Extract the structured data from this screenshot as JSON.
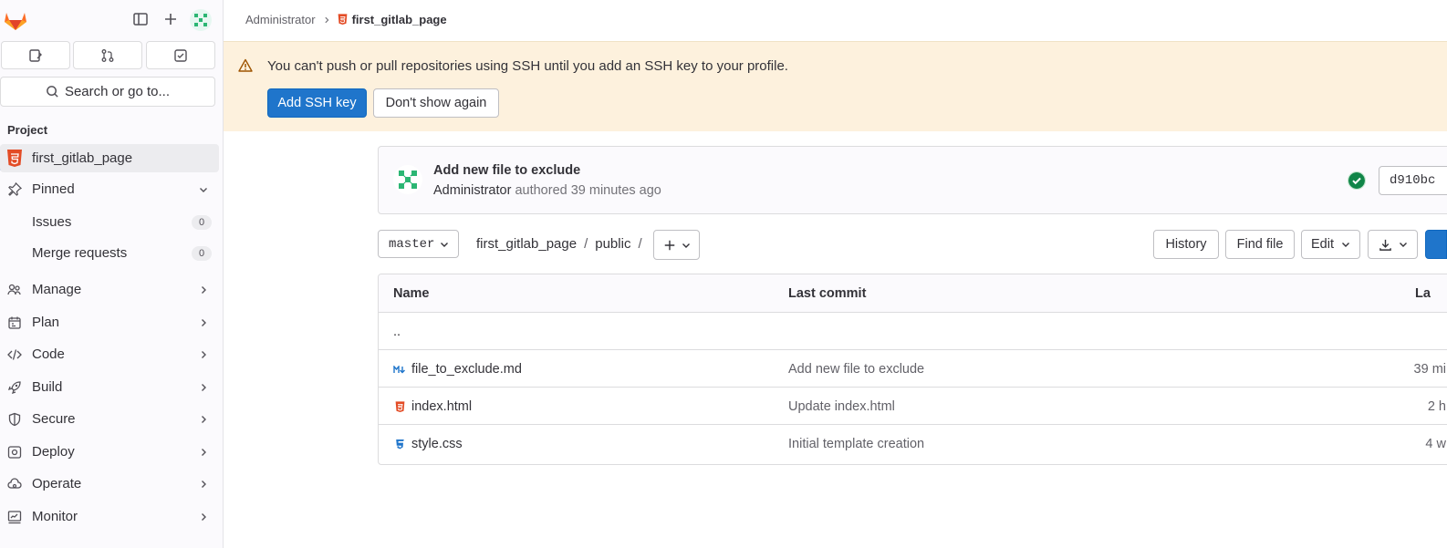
{
  "sidebar": {
    "search_label": "Search or go to...",
    "section_title": "Project",
    "items": [
      {
        "label": "first_gitlab_page"
      },
      {
        "label": "Pinned"
      },
      {
        "label": "Issues",
        "count": "0"
      },
      {
        "label": "Merge requests",
        "count": "0"
      },
      {
        "label": "Manage"
      },
      {
        "label": "Plan"
      },
      {
        "label": "Code"
      },
      {
        "label": "Build"
      },
      {
        "label": "Secure"
      },
      {
        "label": "Deploy"
      },
      {
        "label": "Operate"
      },
      {
        "label": "Monitor"
      }
    ]
  },
  "breadcrumb": {
    "root": "Administrator",
    "current": "first_gitlab_page"
  },
  "banner": {
    "message": "You can't push or pull repositories using SSH until you add an SSH key to your profile.",
    "primary_label": "Add SSH key",
    "secondary_label": "Don't show again"
  },
  "commit": {
    "title": "Add new file to exclude",
    "author": "Administrator",
    "meta": "authored 39 minutes ago",
    "sha": "d910bc"
  },
  "toolbar": {
    "branch": "master",
    "path": [
      "first_gitlab_page",
      "public"
    ],
    "history_label": "History",
    "find_file_label": "Find file",
    "edit_label": "Edit"
  },
  "table": {
    "headers": {
      "name": "Name",
      "last_commit": "Last commit",
      "last_update": "La"
    },
    "parent": "..",
    "rows": [
      {
        "name": "file_to_exclude.md",
        "commit": "Add new file to exclude",
        "date": "39 mi",
        "icon": "markdown-icon"
      },
      {
        "name": "index.html",
        "commit": "Update index.html",
        "date": "2 h",
        "icon": "html-icon"
      },
      {
        "name": "style.css",
        "commit": "Initial template creation",
        "date": "4 w",
        "icon": "css-icon"
      }
    ]
  },
  "colors": {
    "accent": "#1f75cb",
    "banner_bg": "#fdf1dd",
    "success": "#108548"
  }
}
